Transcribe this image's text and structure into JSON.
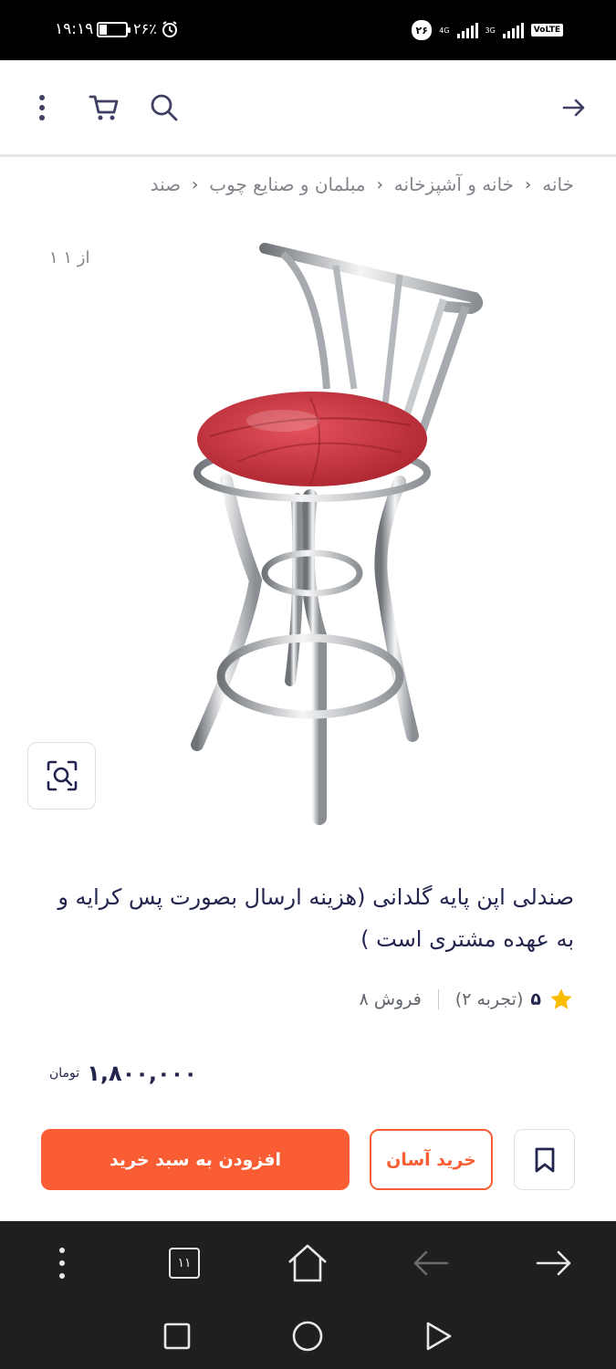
{
  "status_bar": {
    "time": "۱۹:۱۹",
    "battery_percent": "۲۶٪",
    "battery_level": 0.26,
    "sim_badge": "۲۶",
    "network_1": "4G",
    "network_2": "3G",
    "volte": "VoLTE"
  },
  "header": {
    "back_icon": "arrow-right-icon",
    "search_icon": "search-icon",
    "cart_icon": "cart-icon",
    "more_icon": "more-vertical-icon"
  },
  "breadcrumb": {
    "items": [
      "خانه",
      "خانه و آشپزخانه",
      "مبلمان و صنایع چوب",
      "صند"
    ]
  },
  "gallery": {
    "counter": "۱ از ۱",
    "zoom_icon": "image-zoom-icon"
  },
  "product": {
    "title": "صندلی اپن پایه گلدانی (هزینه ارسال بصورت پس کرایه و به عهده مشتری است )",
    "rating_score": "۵",
    "rating_count": "(۲ تجربه)",
    "sales": "۸ فروش",
    "price": "۱,۸۰۰,۰۰۰",
    "currency": "تومان",
    "star_color": "#f9bc00"
  },
  "actions": {
    "add_to_cart": "افزودن به سبد خرید",
    "easy_buy": "خرید آسان",
    "bookmark_icon": "bookmark-icon",
    "accent_color": "#fa5c34"
  },
  "browser_toolbar": {
    "tab_count": "۱۱"
  }
}
